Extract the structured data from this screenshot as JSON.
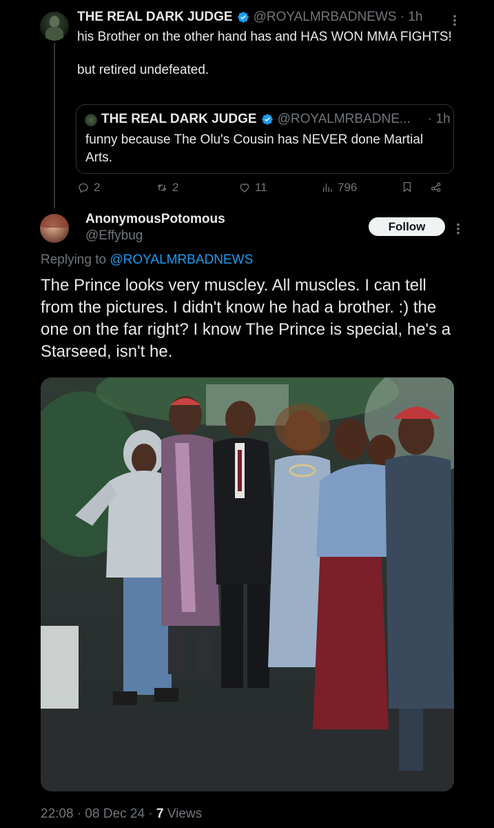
{
  "top_tweet": {
    "author_name": "THE REAL DARK JUDGE",
    "handle": "@ROYALMRBADNEWS",
    "separator": "·",
    "time": "1h",
    "body": "his Brother on the other hand has and HAS WON MMA FIGHTS!\n\nbut retired undefeated.",
    "quoted": {
      "author_name": "THE REAL DARK JUDGE",
      "handle": "@ROYALMRBADNE...",
      "time": "· 1h",
      "body": "funny because The Olu's Cousin has NEVER done Martial Arts."
    },
    "actions": {
      "replies": "2",
      "reposts": "2",
      "likes": "11",
      "views": "796"
    }
  },
  "reply_tweet": {
    "author_name": "AnonymousPotomous",
    "handle": "@Effybug",
    "follow_label": "Follow",
    "replying_prefix": "Replying to ",
    "replying_to": "@ROYALMRBADNEWS",
    "body": "The Prince looks very muscley.  All muscles. I can tell from the pictures. I didn't know he had a brother. :) the one on the far right?  I know The Prince is special, he's a Starseed, isn't he.",
    "timestamp": "22:08 · 08 Dec 24 · ",
    "views_count": "7",
    "views_label": " Views"
  },
  "colors": {
    "background": "#000000",
    "text_primary": "#e7e9ea",
    "text_secondary": "#71767b",
    "link": "#1d9bf0",
    "verified_badge": "#1d9bf0",
    "follow_button_bg": "#eff3f4"
  },
  "icons": [
    "more-icon",
    "verified-icon",
    "reply-icon",
    "repost-icon",
    "like-icon",
    "views-icon",
    "bookmark-icon",
    "share-icon"
  ]
}
